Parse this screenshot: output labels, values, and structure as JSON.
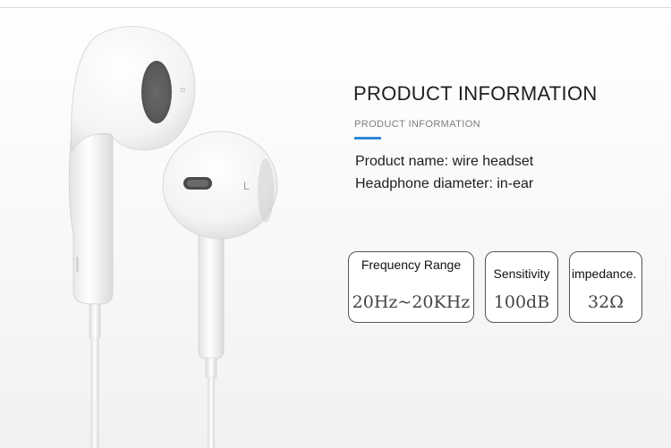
{
  "info": {
    "heading": "PRODUCT INFORMATION",
    "subheading": "PRODUCT INFORMATION",
    "product_name_line": "Product name: wire headset",
    "diameter_line": "Headphone diameter: in-ear",
    "accent_color": "#2f86d4"
  },
  "earbud_markings": {
    "left": "L",
    "right": "R"
  },
  "specs": [
    {
      "label": "Frequency Range",
      "value": "20Hz~20KHz"
    },
    {
      "label": "Sensitivity",
      "value": "100dB"
    },
    {
      "label": "impedance.",
      "value": "32Ω"
    }
  ]
}
